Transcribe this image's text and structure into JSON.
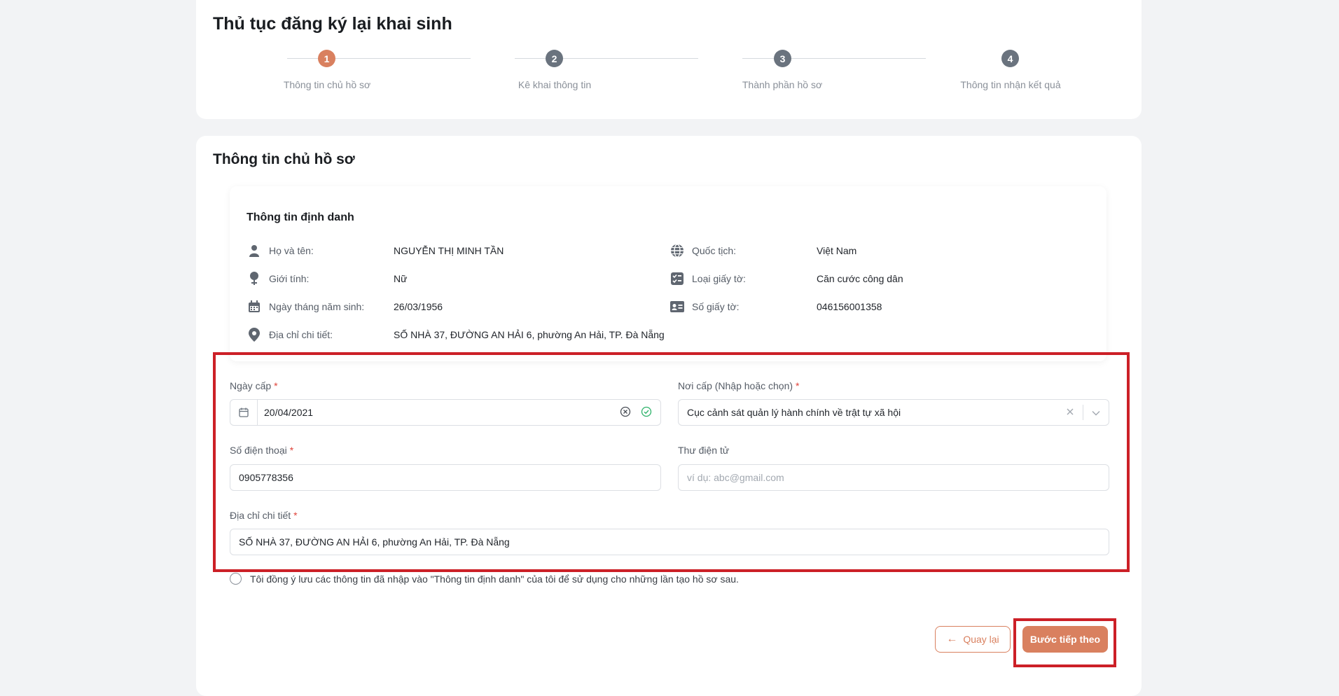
{
  "page_title": "Thủ tục đăng ký lại khai sinh",
  "steps": [
    {
      "number": "1",
      "label": "Thông tin chủ hồ sơ",
      "active": true
    },
    {
      "number": "2",
      "label": "Kê khai thông tin",
      "active": false
    },
    {
      "number": "3",
      "label": "Thành phần hồ sơ",
      "active": false
    },
    {
      "number": "4",
      "label": "Thông tin nhận kết quả",
      "active": false
    }
  ],
  "section_title": "Thông tin chủ hồ sơ",
  "identity": {
    "title": "Thông tin định danh",
    "full_name": {
      "label": "Họ và tên:",
      "value": "NGUYỄN THỊ MINH TẦN",
      "icon": "person-icon"
    },
    "gender": {
      "label": "Giới tính:",
      "value": "Nữ",
      "icon": "gender-icon"
    },
    "dob": {
      "label": "Ngày tháng năm sinh:",
      "value": "26/03/1956",
      "icon": "calendar-icon"
    },
    "address": {
      "label": "Địa chỉ chi tiết:",
      "value": "SỐ NHÀ 37, ĐƯỜNG AN HẢI 6, phường An Hải, TP. Đà Nẵng",
      "icon": "location-pin-icon"
    },
    "nationality": {
      "label": "Quốc tịch:",
      "value": "Việt Nam",
      "icon": "globe-icon"
    },
    "doc_type": {
      "label": "Loại giấy tờ:",
      "value": "Căn cước công dân",
      "icon": "checklist-icon"
    },
    "doc_number": {
      "label": "Số giấy tờ:",
      "value": "046156001358",
      "icon": "id-card-icon"
    }
  },
  "form": {
    "issue_date": {
      "label": "Ngày cấp",
      "value": "20/04/2021"
    },
    "issue_place": {
      "label": "Nơi cấp (Nhập hoặc chọn)",
      "value": "Cục cảnh sát quản lý hành chính về trật tự xã hội"
    },
    "phone": {
      "label": "Số điện thoại",
      "value": "0905778356"
    },
    "email": {
      "label": "Thư điện tử",
      "placeholder": "ví dụ: abc@gmail.com"
    },
    "address": {
      "label": "Địa chỉ chi tiết",
      "value": "SỐ NHÀ 37, ĐƯỜNG AN HẢI 6, phường An Hải, TP. Đà Nẵng"
    },
    "required_mark": "*"
  },
  "consent_text": "Tôi đồng ý lưu các thông tin đã nhập vào \"Thông tin định danh\" của tôi để sử dụng cho những lần tạo hồ sơ sau.",
  "buttons": {
    "back": "Quay lại",
    "back_arrow": "←",
    "next": "Bước tiếp theo"
  },
  "colors": {
    "accent": "#d9805f",
    "highlight": "#cc2027"
  }
}
